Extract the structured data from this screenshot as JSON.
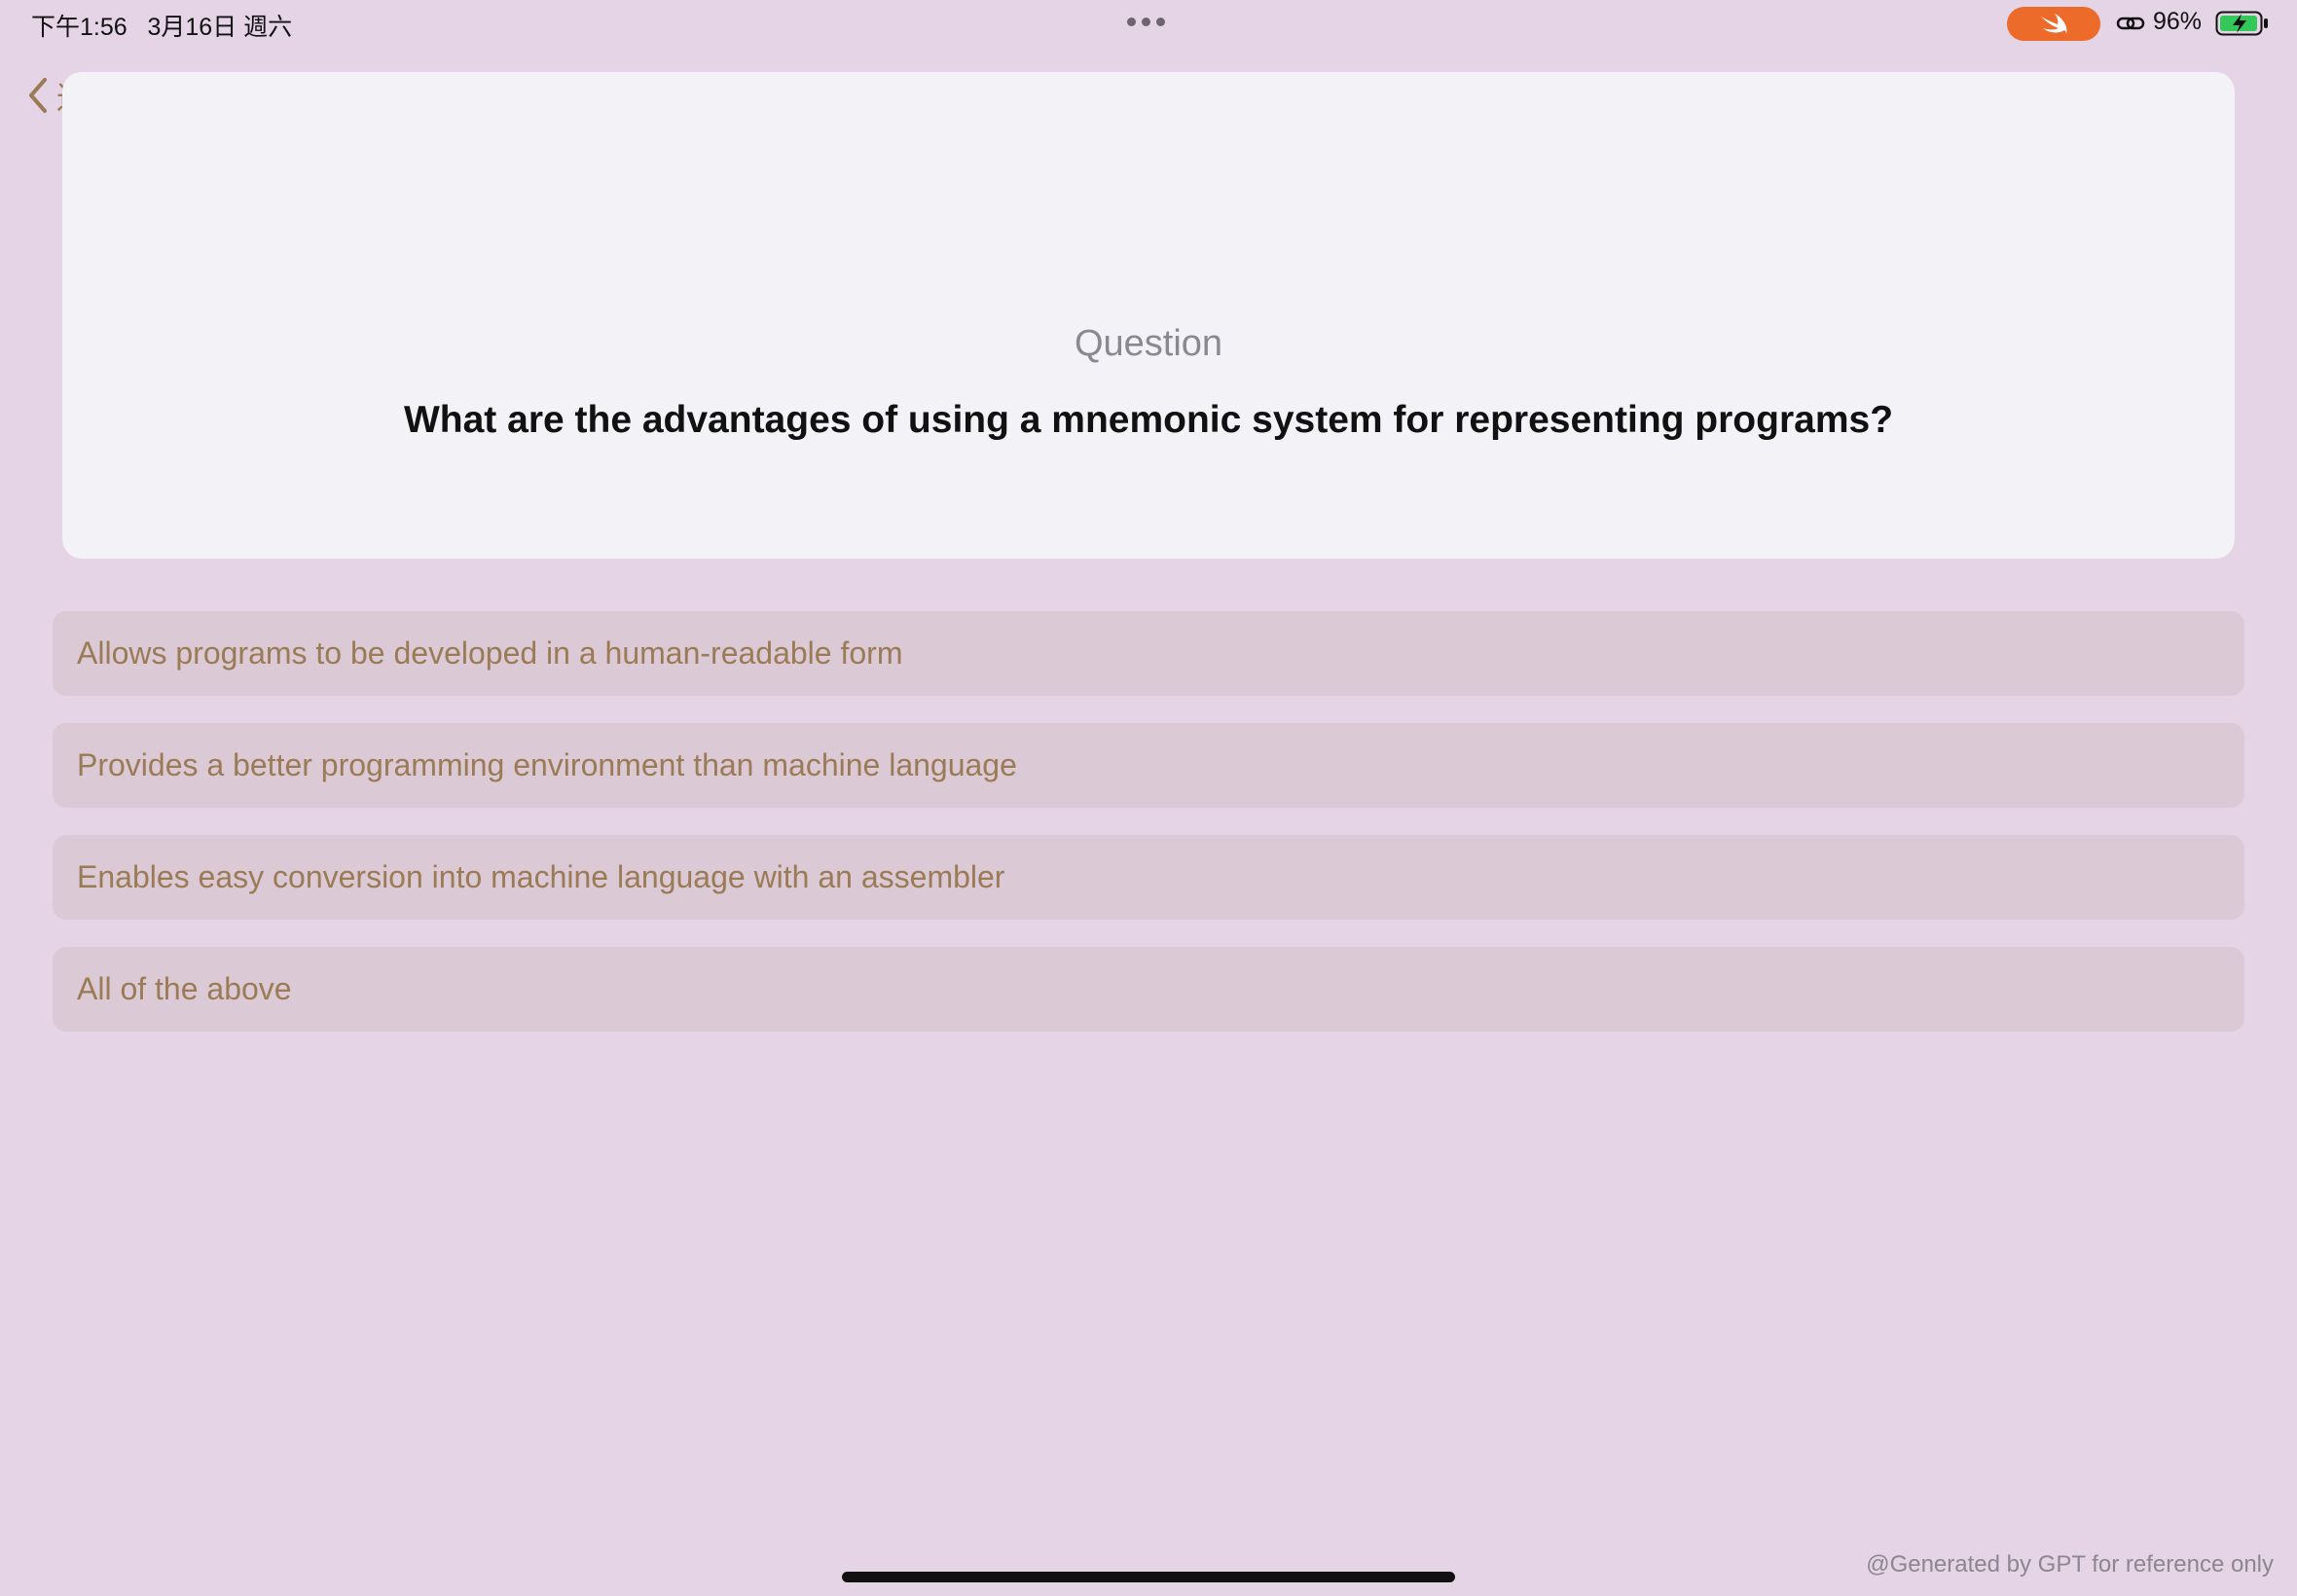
{
  "status_bar": {
    "time": "下午1:56   3月16日 週六",
    "battery_percent": "96%",
    "icons": [
      "swift-icon",
      "link-icon",
      "battery-charging-icon"
    ],
    "swift_pill_color": "#ec6a2a",
    "battery_color": "#34c759"
  },
  "navigation": {
    "back_label": "返回",
    "accent_color": "#9a7b55"
  },
  "question": {
    "heading": "Question",
    "text": "What are the advantages of using a mnemonic system for representing programs?"
  },
  "options": [
    {
      "label": "Allows programs to be developed in a human-readable form"
    },
    {
      "label": "Provides a better programming environment than machine language"
    },
    {
      "label": "Enables easy conversion into machine language with an assembler"
    },
    {
      "label": "All of the above"
    }
  ],
  "footer": {
    "watermark": "@Generated by GPT for reference only"
  }
}
